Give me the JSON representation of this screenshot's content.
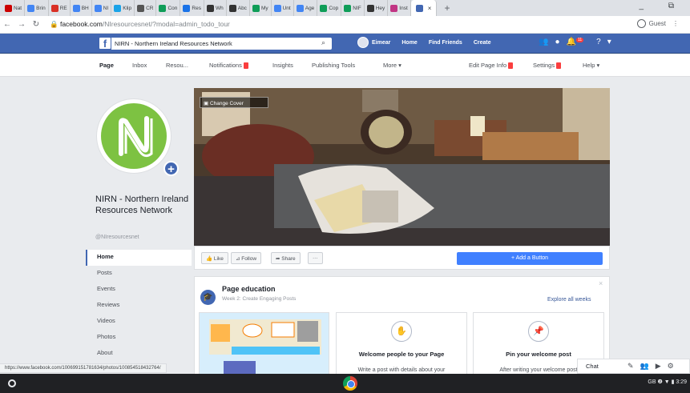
{
  "browser": {
    "tabs": [
      {
        "label": "Nat",
        "color": "#c00"
      },
      {
        "label": "Brin",
        "color": "#4285f4"
      },
      {
        "label": "RE",
        "color": "#d93025"
      },
      {
        "label": "BH",
        "color": "#4285f4"
      },
      {
        "label": "NI",
        "color": "#4285f4"
      },
      {
        "label": "Klip",
        "color": "#1aa3e8"
      },
      {
        "label": "CR",
        "color": "#555"
      },
      {
        "label": "Con",
        "color": "#0f9d58"
      },
      {
        "label": "Res",
        "color": "#1a73e8"
      },
      {
        "label": "Wh",
        "color": "#333"
      },
      {
        "label": "Abc",
        "color": "#333"
      },
      {
        "label": "My",
        "color": "#0f9d58"
      },
      {
        "label": "Unt",
        "color": "#4285f4"
      },
      {
        "label": "Age",
        "color": "#4285f4"
      },
      {
        "label": "Cop",
        "color": "#0f9d58"
      },
      {
        "label": "NIF",
        "color": "#0f9d58"
      },
      {
        "label": "Hey",
        "color": "#333"
      },
      {
        "label": "Inst",
        "color": "#c13584"
      }
    ],
    "active_tab_label": "",
    "url_main": "facebook.com",
    "url_rest": "/NIresourcesnet/?modal=admin_todo_tour",
    "guest_label": "Guest",
    "status_url": "https://www.facebook.com/100699151781634/photos/100854518432764/"
  },
  "fb": {
    "search_value": "NIRN - Northern Ireland Resources Network",
    "user_name": "Eimear",
    "home": "Home",
    "find_friends": "Find Friends",
    "create": "Create",
    "notif_count": "11"
  },
  "pagenav": {
    "page": "Page",
    "inbox": "Inbox",
    "resources": "Resou...",
    "notifications": "Notifications",
    "insights": "Insights",
    "publishing": "Publishing Tools",
    "more": "More ▾",
    "edit_info": "Edit Page Info",
    "settings": "Settings",
    "help": "Help ▾"
  },
  "page": {
    "name": "NIRN - Northern Ireland Resources Network",
    "handle": "@NIresourcesnet",
    "nav": [
      "Home",
      "Posts",
      "Events",
      "Reviews",
      "Videos",
      "Photos",
      "About"
    ],
    "change_cover": "Change Cover",
    "like": "Like",
    "follow": "Follow",
    "share": "Share",
    "more": "···",
    "add_button": "+ Add a Button"
  },
  "education": {
    "title": "Page education",
    "subtitle": "Week 2: Create Engaging Posts",
    "explore": "Explore all weeks",
    "card2_title": "Welcome people to your Page",
    "card2_desc": "Write a post with details about your",
    "card3_title": "Pin your welcome post",
    "card3_desc": "After writing your welcome post"
  },
  "chat": {
    "label": "Chat"
  },
  "system": {
    "tray": "GB  ❷  ▼  ▮ 3:29"
  }
}
